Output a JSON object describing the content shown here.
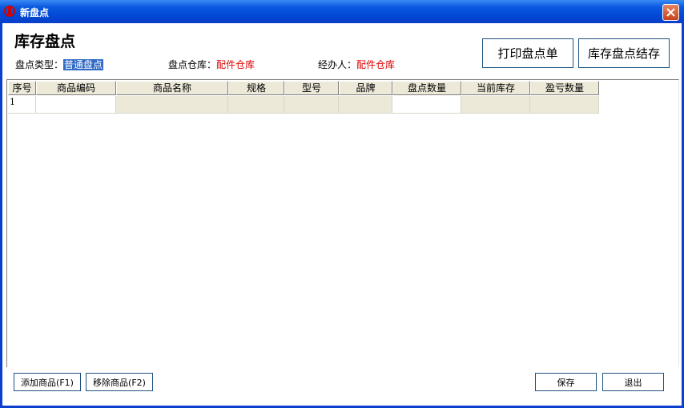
{
  "window": {
    "title": "新盘点",
    "close_icon": "close-icon"
  },
  "header": {
    "title": "库存盘点",
    "fields": {
      "type_label": "盘点类型：",
      "type_value": "普通盘点",
      "warehouse_label": "盘点仓库：",
      "warehouse_value": "配件仓库",
      "handler_label": "经办人：",
      "handler_value": "配件仓库"
    },
    "buttons": {
      "print": "打印盘点单",
      "settle": "库存盘点结存"
    }
  },
  "grid": {
    "columns": [
      "序号",
      "商品编码",
      "商品名称",
      "规格",
      "型号",
      "品牌",
      "盘点数量",
      "当前库存",
      "盈亏数量"
    ],
    "rows": [
      {
        "seq": "1"
      }
    ]
  },
  "footer": {
    "add": "添加商品(F1)",
    "remove": "移除商品(F2)",
    "save": "保存",
    "exit": "退出"
  },
  "colors": {
    "titlebar": "#0a5ae0",
    "value_red": "#e00000",
    "selection": "#316ac5",
    "readonly_cell": "#ece9d8"
  }
}
